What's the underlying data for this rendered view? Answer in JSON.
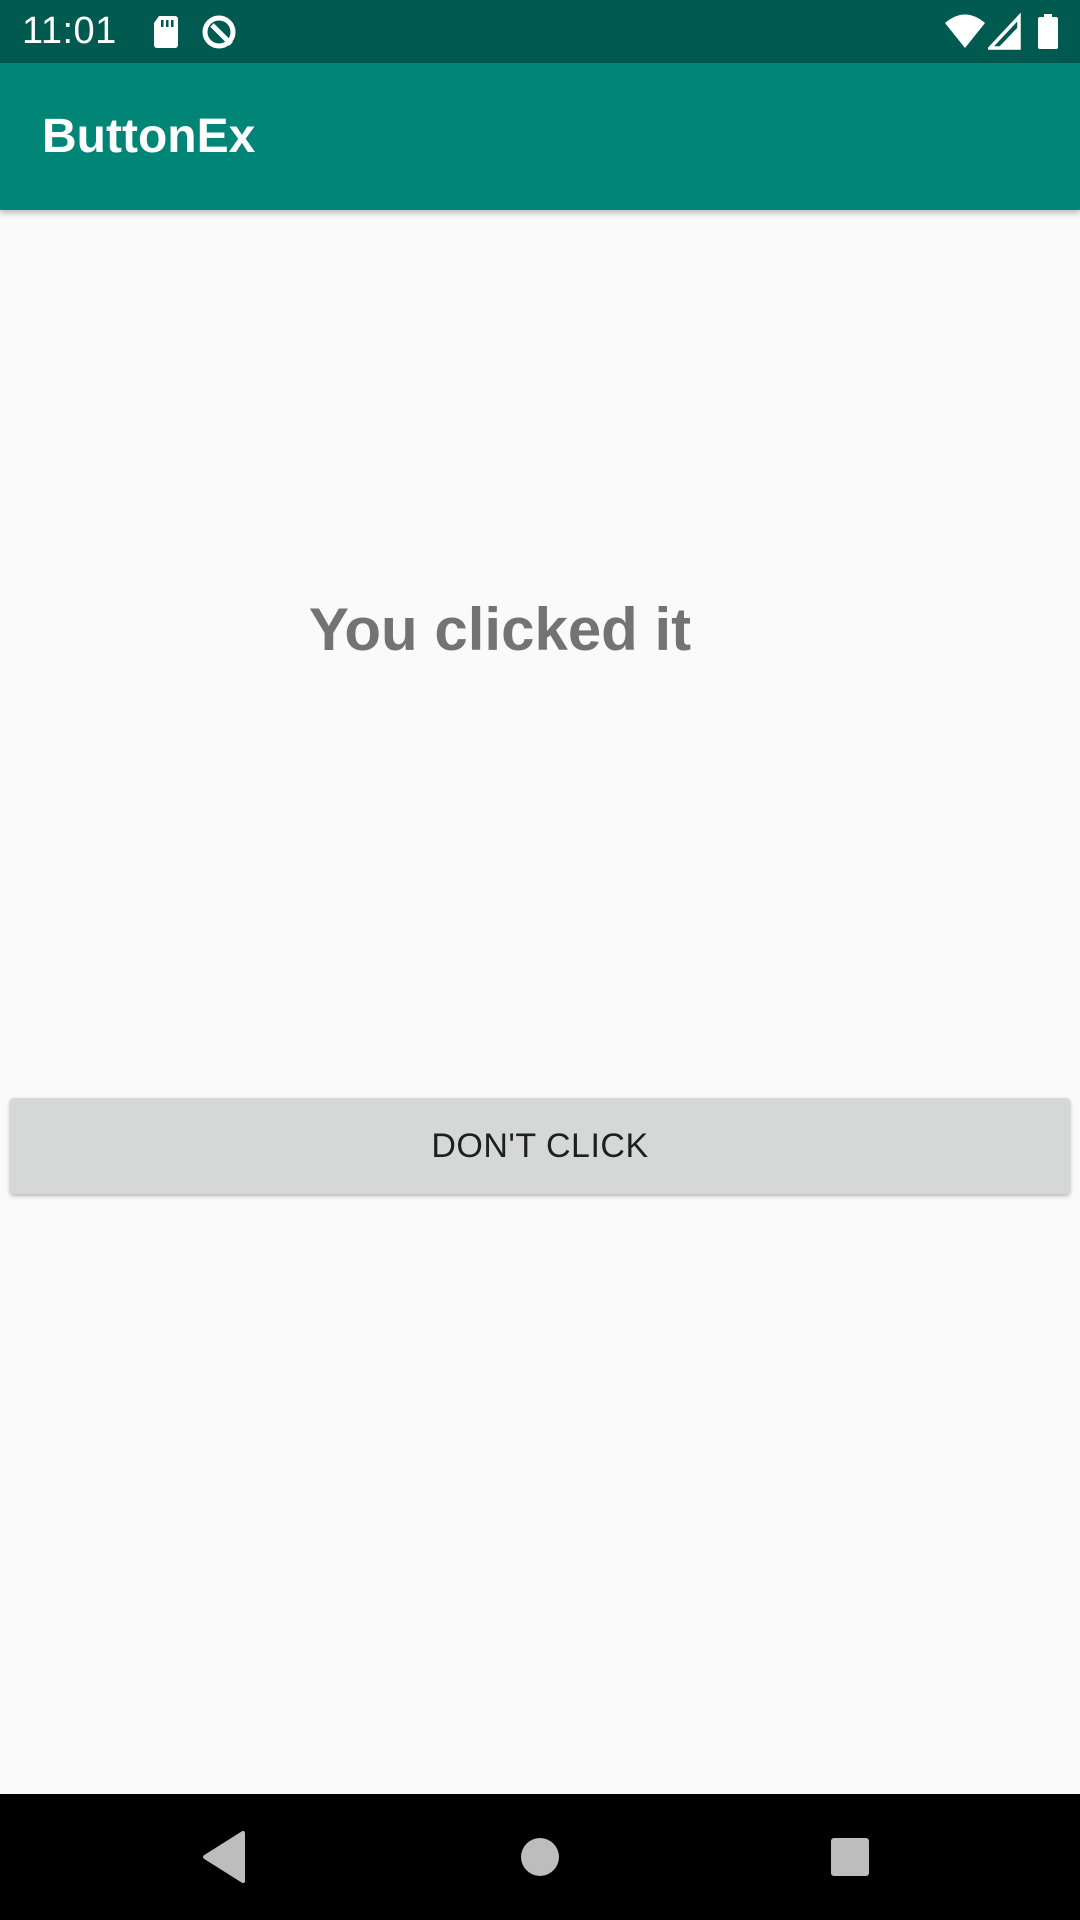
{
  "status_bar": {
    "time": "11:01",
    "left_icons": [
      "sd-card-icon",
      "data-saver-icon"
    ],
    "right_icons": [
      "wifi-icon",
      "cell-signal-icon",
      "battery-icon"
    ],
    "background_color": "#005a4f"
  },
  "app_bar": {
    "title": "ButtonEx",
    "background_color": "#008577"
  },
  "main": {
    "message": "You clicked it",
    "button_label": "DON'T CLICK"
  },
  "nav_bar": {
    "buttons": [
      "back-icon",
      "home-icon",
      "recents-icon"
    ]
  }
}
